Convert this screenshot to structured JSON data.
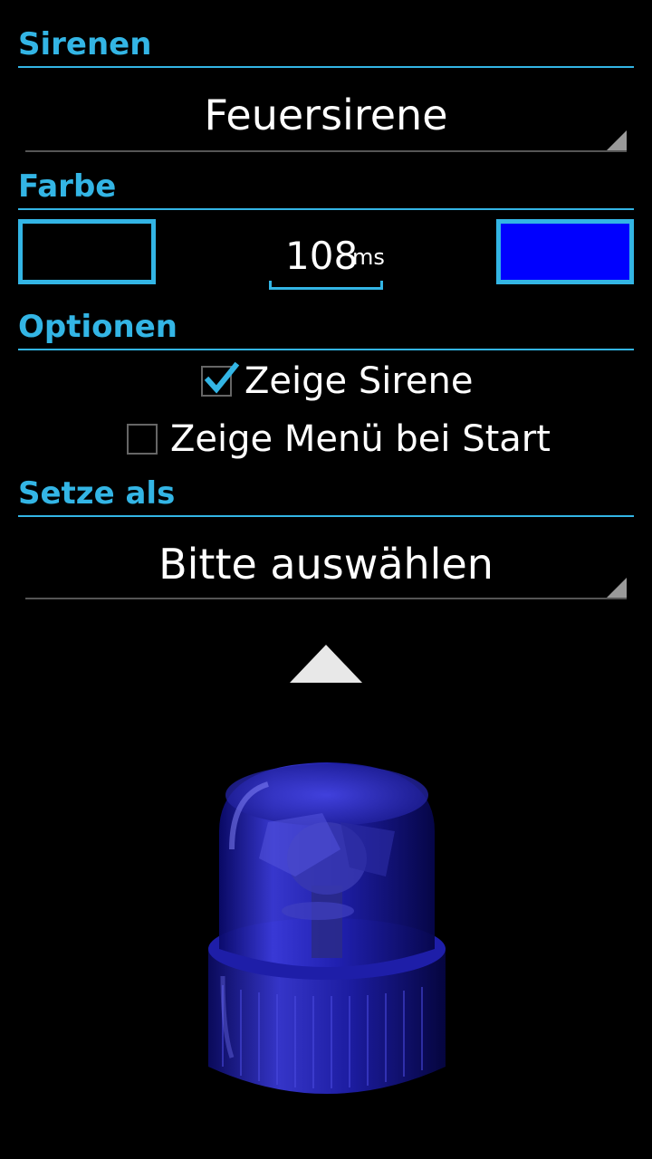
{
  "sections": {
    "sirens_title": "Sirenen",
    "color_title": "Farbe",
    "options_title": "Optionen",
    "set_as_title": "Setze als"
  },
  "siren_spinner": {
    "selected": "Feuersirene"
  },
  "color": {
    "interval_value": "108",
    "interval_unit": "ms",
    "color_off": "#000000",
    "color_on": "#0000ff",
    "accent": "#33b5e5"
  },
  "options": {
    "show_siren": {
      "label": "Zeige Sirene",
      "checked": true
    },
    "show_menu_on_start": {
      "label": "Zeige Menü bei Start",
      "checked": false
    }
  },
  "set_as_spinner": {
    "selected": "Bitte auswählen"
  },
  "icons": {
    "collapse": "arrow-up-icon",
    "beacon": "blue-beacon-icon"
  }
}
